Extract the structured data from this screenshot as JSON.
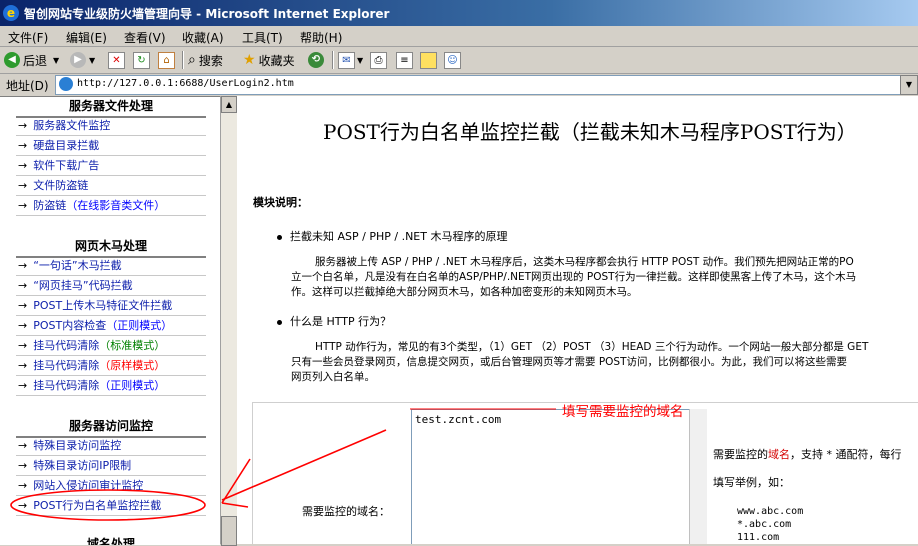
{
  "window": {
    "title": "智创网站专业级防火墙管理向导 - Microsoft Internet Explorer"
  },
  "menu": [
    {
      "label": "文件(F)"
    },
    {
      "label": "编辑(E)"
    },
    {
      "label": "查看(V)"
    },
    {
      "label": "收藏(A)"
    },
    {
      "label": "工具(T)"
    },
    {
      "label": "帮助(H)"
    }
  ],
  "toolbar": {
    "back_label": "后退",
    "search_label": "搜索",
    "favorites_label": "收藏夹"
  },
  "address": {
    "label": "地址(D)",
    "url": "http://127.0.0.1:6688/UserLogin2.htm"
  },
  "sidebar": {
    "section1": {
      "title": "服务器文件处理",
      "items": [
        "服务器文件监控",
        "硬盘目录拦截",
        "软件下载广告",
        "文件防盗链"
      ],
      "item5_main": "防盗链",
      "item5_paren": "（在线影音类文件）"
    },
    "section2": {
      "title": "网页木马处理",
      "items": [
        "“一句话”木马拦截",
        "“网页挂马”代码拦截",
        "POST上传木马特征文件拦截"
      ],
      "post_check": "POST内容检查",
      "post_check_mode": "（正则模式）",
      "hang1": "挂马代码清除",
      "hang1_mode": "（标准模式）",
      "hang2": "挂马代码清除",
      "hang2_mode": "（原样模式）",
      "hang3": "挂马代码清除",
      "hang3_mode": "（正则模式）"
    },
    "section3": {
      "title": "服务器访问监控",
      "items": [
        "特殊目录访问监控",
        "特殊目录访问IP限制",
        "网站入侵访问审计监控",
        "POST行为白名单监控拦截"
      ]
    },
    "section4": {
      "title": "域名处理"
    }
  },
  "main": {
    "title": "POST行为白名单监控拦截（拦截未知木马程序POST行为）",
    "module_label": "模块说明：",
    "bullet1": "拦截未知 ASP / PHP / .NET 木马程序的原理",
    "para1": [
      "服务器被上传 ASP / PHP / .NET 木马程序后，这类木马程序都会执行 HTTP POST 动作。我们预先把网站正常的PO",
      "立一个白名单，凡是没有在白名单的ASP/PHP/.NET网页出现的 POST行为一律拦截。这样即使黑客上传了木马，这个木马",
      "作。这样可以拦截掉绝大部分网页木马，如各种加密变形的未知网页木马。"
    ],
    "bullet2": "什么是 HTTP 行为？",
    "para2": [
      "HTTP 动作行为，常见的有3个类型，（1）GET （2）POST （3）HEAD 三个行为动作。一个网站一般大部分都是 GET",
      "只有一些会员登录网页，信息提交网页，或后台管理网页等才需要 POST访问，比例都很小。为此，我们可以将这些需要",
      "网页列入白名单。"
    ],
    "form": {
      "field_label": "需要监控的域名：",
      "domain_value": "test.zcnt.com",
      "help_pre": "需要监控的",
      "help_red": "域名",
      "help_post": "，支持 * 通配符，每行",
      "example_label": "填写举例，如：",
      "examples": [
        "www.abc.com",
        "*.abc.com",
        "111.com"
      ]
    }
  },
  "annotation": {
    "text": "填写需要监控的域名"
  },
  "colors": {
    "title_bar": "#0a246a",
    "link": "#0a1caa",
    "annotation": "#ff0000"
  }
}
